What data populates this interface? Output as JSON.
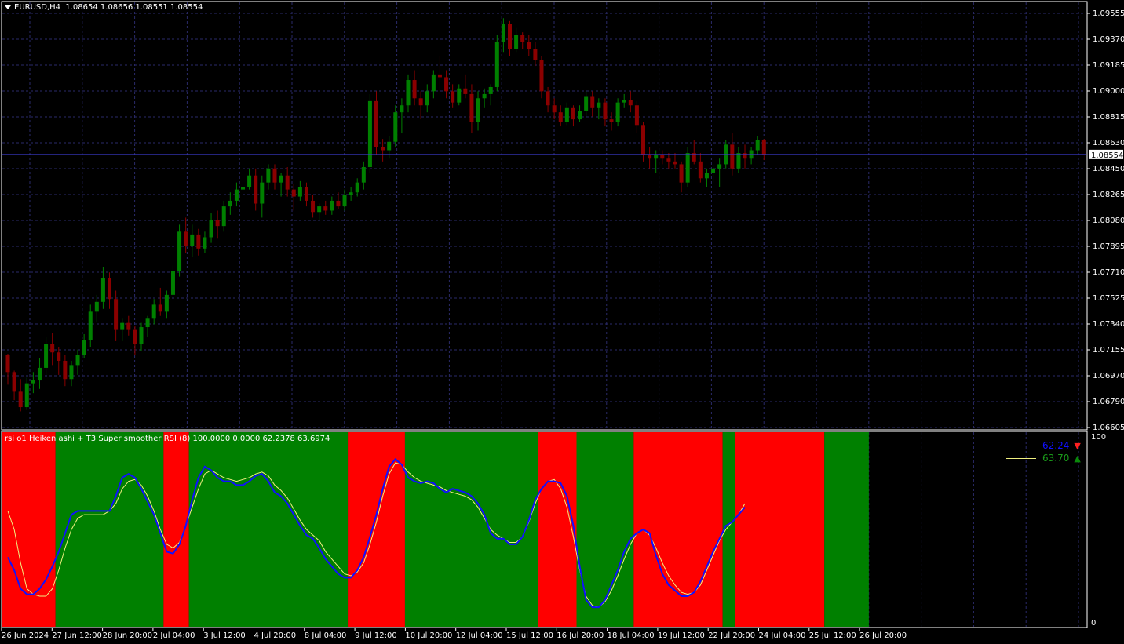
{
  "header": {
    "symbol": "EURUSD,H4",
    "ohlc": "1.08654 1.08656 1.08551 1.08554"
  },
  "price_axis": {
    "ticks": [
      "1.09555",
      "1.09370",
      "1.09185",
      "1.09000",
      "1.08815",
      "1.08630",
      "1.08450",
      "1.08265",
      "1.08080",
      "1.07895",
      "1.07710",
      "1.07525",
      "1.07340",
      "1.07155",
      "1.06970",
      "1.06790",
      "1.06605"
    ],
    "current_price": "1.08554"
  },
  "indicator": {
    "title": "rsi o1 Heiken ashi + T3 Super smoother RSI (8) 100.0000 0.0000 62.2378 63.6974",
    "scale_max": "100",
    "scale_min": "0",
    "legend": [
      {
        "value": "62.24",
        "color": "#1010ff",
        "arrow": "▼",
        "arrow_color": "#ff2020",
        "icon": "down-arrow-icon"
      },
      {
        "value": "63.70",
        "color": "#f0f080",
        "arrow": "▲",
        "arrow_color": "#0a8a0a",
        "icon": "up-arrow-icon"
      }
    ]
  },
  "time_axis": [
    "26 Jun 2024",
    "27 Jun 12:00",
    "28 Jun 20:00",
    "2 Jul 04:00",
    "3 Jul 12:00",
    "4 Jul 20:00",
    "8 Jul 04:00",
    "9 Jul 12:00",
    "10 Jul 20:00",
    "12 Jul 04:00",
    "15 Jul 12:00",
    "16 Jul 20:00",
    "18 Jul 04:00",
    "19 Jul 12:00",
    "22 Jul 20:00",
    "24 Jul 04:00",
    "25 Jul 12:00",
    "26 Jul 20:00"
  ],
  "colors": {
    "background": "#000000",
    "grid": "#2a2a6a",
    "bull": "#008000",
    "bear": "#8b0000",
    "zone_up": "#008000",
    "zone_down": "#ff0000",
    "rsi_line": "#1010ff",
    "signal_line": "#f0f080"
  },
  "chart_data": {
    "type": "candlestick",
    "title": "EURUSD,H4",
    "ylim": [
      1.06605,
      1.09555
    ],
    "candles": [
      [
        1.0712,
        1.0713,
        1.0691,
        1.07
      ],
      [
        1.07,
        1.0701,
        1.068,
        1.0686
      ],
      [
        1.0686,
        1.0695,
        1.0672,
        1.0675
      ],
      [
        1.0675,
        1.0696,
        1.0673,
        1.0692
      ],
      [
        1.0692,
        1.07,
        1.0685,
        1.0694
      ],
      [
        1.0694,
        1.071,
        1.0688,
        1.0703
      ],
      [
        1.0703,
        1.0725,
        1.0698,
        1.072
      ],
      [
        1.072,
        1.0728,
        1.0705,
        1.0714
      ],
      [
        1.0714,
        1.0718,
        1.0698,
        1.0708
      ],
      [
        1.0708,
        1.0712,
        1.069,
        1.0695
      ],
      [
        1.0695,
        1.0708,
        1.069,
        1.0705
      ],
      [
        1.0705,
        1.0716,
        1.0698,
        1.0712
      ],
      [
        1.0712,
        1.0727,
        1.071,
        1.0723
      ],
      [
        1.0723,
        1.0748,
        1.0718,
        1.0743
      ],
      [
        1.0743,
        1.0755,
        1.0736,
        1.075
      ],
      [
        1.075,
        1.0775,
        1.0745,
        1.0767
      ],
      [
        1.0767,
        1.0771,
        1.0745,
        1.0752
      ],
      [
        1.0752,
        1.0758,
        1.0722,
        1.073
      ],
      [
        1.073,
        1.0738,
        1.0722,
        1.0735
      ],
      [
        1.0735,
        1.074,
        1.0726,
        1.073
      ],
      [
        1.073,
        1.0733,
        1.0712,
        1.072
      ],
      [
        1.072,
        1.0735,
        1.0715,
        1.0732
      ],
      [
        1.0732,
        1.074,
        1.0725,
        1.0738
      ],
      [
        1.0738,
        1.0752,
        1.0734,
        1.0748
      ],
      [
        1.0748,
        1.076,
        1.074,
        1.0743
      ],
      [
        1.0743,
        1.0758,
        1.0738,
        1.0755
      ],
      [
        1.0755,
        1.0776,
        1.0752,
        1.0772
      ],
      [
        1.0772,
        1.0805,
        1.0768,
        1.08
      ],
      [
        1.08,
        1.081,
        1.0785,
        1.079
      ],
      [
        1.079,
        1.0805,
        1.0782,
        1.0798
      ],
      [
        1.0798,
        1.0802,
        1.0783,
        1.0788
      ],
      [
        1.0788,
        1.08,
        1.0785,
        1.0796
      ],
      [
        1.0796,
        1.0813,
        1.0792,
        1.0808
      ],
      [
        1.0808,
        1.0815,
        1.0795,
        1.0804
      ],
      [
        1.0804,
        1.0822,
        1.08,
        1.0818
      ],
      [
        1.0818,
        1.0828,
        1.0812,
        1.0822
      ],
      [
        1.0822,
        1.0835,
        1.0818,
        1.083
      ],
      [
        1.083,
        1.084,
        1.082,
        1.0832
      ],
      [
        1.0832,
        1.0845,
        1.083,
        1.084
      ],
      [
        1.084,
        1.0845,
        1.0815,
        1.082
      ],
      [
        1.082,
        1.084,
        1.081,
        1.0835
      ],
      [
        1.0835,
        1.0848,
        1.083,
        1.0845
      ],
      [
        1.0845,
        1.0848,
        1.083,
        1.0835
      ],
      [
        1.0835,
        1.0842,
        1.0825,
        1.084
      ],
      [
        1.084,
        1.0846,
        1.0825,
        1.083
      ],
      [
        1.083,
        1.0834,
        1.0815,
        1.0825
      ],
      [
        1.0825,
        1.0836,
        1.0822,
        1.0832
      ],
      [
        1.0832,
        1.0835,
        1.0818,
        1.0822
      ],
      [
        1.0822,
        1.0826,
        1.081,
        1.0814
      ],
      [
        1.0814,
        1.082,
        1.0808,
        1.0818
      ],
      [
        1.0818,
        1.0822,
        1.0812,
        1.0815
      ],
      [
        1.0815,
        1.0825,
        1.0812,
        1.0822
      ],
      [
        1.0822,
        1.0828,
        1.0816,
        1.0818
      ],
      [
        1.0818,
        1.083,
        1.0815,
        1.0826
      ],
      [
        1.0826,
        1.0832,
        1.0822,
        1.0828
      ],
      [
        1.0828,
        1.0838,
        1.0825,
        1.0835
      ],
      [
        1.0835,
        1.085,
        1.083,
        1.0846
      ],
      [
        1.0846,
        1.0898,
        1.0842,
        1.0893
      ],
      [
        1.0893,
        1.09,
        1.0855,
        1.086
      ],
      [
        1.086,
        1.0866,
        1.085,
        1.0858
      ],
      [
        1.0858,
        1.0868,
        1.0852,
        1.0864
      ],
      [
        1.0864,
        1.089,
        1.086,
        1.0885
      ],
      [
        1.0885,
        1.0895,
        1.087,
        1.089
      ],
      [
        1.089,
        1.0912,
        1.0885,
        1.0908
      ],
      [
        1.0908,
        1.0915,
        1.089,
        1.0895
      ],
      [
        1.0895,
        1.09,
        1.088,
        1.089
      ],
      [
        1.089,
        1.0905,
        1.0885,
        1.09
      ],
      [
        1.09,
        1.0915,
        1.0895,
        1.0912
      ],
      [
        1.0912,
        1.0925,
        1.09,
        1.091
      ],
      [
        1.091,
        1.0915,
        1.0895,
        1.09
      ],
      [
        1.09,
        1.0905,
        1.0888,
        1.0892
      ],
      [
        1.0892,
        1.0905,
        1.089,
        1.0902
      ],
      [
        1.0902,
        1.0912,
        1.0895,
        1.0898
      ],
      [
        1.0898,
        1.0905,
        1.087,
        1.0878
      ],
      [
        1.0878,
        1.09,
        1.0872,
        1.0895
      ],
      [
        1.0895,
        1.0902,
        1.0888,
        1.0898
      ],
      [
        1.0898,
        1.0905,
        1.089,
        1.0903
      ],
      [
        1.0903,
        1.094,
        1.09,
        1.0935
      ],
      [
        1.0935,
        1.0952,
        1.0928,
        1.0948
      ],
      [
        1.0948,
        1.095,
        1.0925,
        1.093
      ],
      [
        1.093,
        1.0945,
        1.0928,
        1.094
      ],
      [
        1.094,
        1.0942,
        1.093,
        1.0935
      ],
      [
        1.0935,
        1.094,
        1.0925,
        1.093
      ],
      [
        1.093,
        1.0935,
        1.0918,
        1.0922
      ],
      [
        1.0922,
        1.0925,
        1.0895,
        1.09
      ],
      [
        1.09,
        1.0903,
        1.0885,
        1.089
      ],
      [
        1.089,
        1.0895,
        1.088,
        1.0885
      ],
      [
        1.0885,
        1.089,
        1.0875,
        1.0878
      ],
      [
        1.0878,
        1.0892,
        1.0876,
        1.0888
      ],
      [
        1.0888,
        1.089,
        1.0875,
        1.088
      ],
      [
        1.088,
        1.089,
        1.0878,
        1.0886
      ],
      [
        1.0886,
        1.09,
        1.0882,
        1.0896
      ],
      [
        1.0896,
        1.09,
        1.0882,
        1.0888
      ],
      [
        1.0888,
        1.0895,
        1.088,
        1.0892
      ],
      [
        1.0892,
        1.0895,
        1.0875,
        1.088
      ],
      [
        1.088,
        1.0885,
        1.0872,
        1.0878
      ],
      [
        1.0878,
        1.0895,
        1.0875,
        1.0892
      ],
      [
        1.0892,
        1.0898,
        1.0888,
        1.0894
      ],
      [
        1.0894,
        1.09,
        1.0885,
        1.089
      ],
      [
        1.089,
        1.0893,
        1.087,
        1.0876
      ],
      [
        1.0876,
        1.0878,
        1.085,
        1.0855
      ],
      [
        1.0855,
        1.086,
        1.0845,
        1.0852
      ],
      [
        1.0852,
        1.0858,
        1.0842,
        1.0855
      ],
      [
        1.0855,
        1.0858,
        1.0848,
        1.0852
      ],
      [
        1.0852,
        1.0856,
        1.0845,
        1.085
      ],
      [
        1.085,
        1.0856,
        1.0845,
        1.0848
      ],
      [
        1.0848,
        1.085,
        1.0828,
        1.0835
      ],
      [
        1.0835,
        1.086,
        1.0832,
        1.0856
      ],
      [
        1.0856,
        1.0865,
        1.0848,
        1.085
      ],
      [
        1.085,
        1.0856,
        1.0835,
        1.0838
      ],
      [
        1.0838,
        1.0845,
        1.0832,
        1.0842
      ],
      [
        1.0842,
        1.0848,
        1.0835,
        1.0845
      ],
      [
        1.0845,
        1.0852,
        1.0832,
        1.0848
      ],
      [
        1.0848,
        1.0865,
        1.0845,
        1.0862
      ],
      [
        1.0862,
        1.087,
        1.084,
        1.0845
      ],
      [
        1.0845,
        1.086,
        1.0842,
        1.0856
      ],
      [
        1.0856,
        1.0862,
        1.0845,
        1.0852
      ],
      [
        1.0852,
        1.086,
        1.0848,
        1.0858
      ],
      [
        1.0858,
        1.0868,
        1.0855,
        1.0865
      ],
      [
        1.0865,
        1.0866,
        1.0851,
        1.0855
      ]
    ]
  },
  "indicator_data": {
    "scale": [
      0,
      100
    ],
    "zones": [
      {
        "from": 0,
        "to": 8,
        "state": "down"
      },
      {
        "from": 8,
        "to": 25,
        "state": "up"
      },
      {
        "from": 25,
        "to": 29,
        "state": "down"
      },
      {
        "from": 29,
        "to": 54,
        "state": "up"
      },
      {
        "from": 54,
        "to": 63,
        "state": "down"
      },
      {
        "from": 63,
        "to": 84,
        "state": "up"
      },
      {
        "from": 84,
        "to": 90,
        "state": "down"
      },
      {
        "from": 90,
        "to": 99,
        "state": "up"
      },
      {
        "from": 99,
        "to": 113,
        "state": "down"
      },
      {
        "from": 113,
        "to": 115,
        "state": "up"
      },
      {
        "from": 115,
        "to": 129,
        "state": "down"
      },
      {
        "from": 129,
        "to": 136,
        "state": "up"
      }
    ],
    "rsi": [
      35,
      28,
      18,
      15,
      15,
      18,
      23,
      30,
      38,
      48,
      58,
      60,
      60,
      60,
      60,
      60,
      60,
      68,
      78,
      80,
      78,
      72,
      65,
      58,
      48,
      38,
      37,
      42,
      52,
      66,
      78,
      84,
      82,
      78,
      76,
      76,
      74,
      74,
      76,
      79,
      80,
      76,
      70,
      68,
      64,
      58,
      52,
      47,
      45,
      40,
      34,
      30,
      26,
      24,
      24,
      28,
      35,
      46,
      58,
      72,
      84,
      88,
      85,
      78,
      76,
      75,
      76,
      75,
      72,
      70,
      72,
      71,
      70,
      68,
      64,
      58,
      48,
      45,
      45,
      42,
      42,
      46,
      55,
      66,
      72,
      76,
      76,
      75,
      68,
      52,
      30,
      12,
      8,
      8,
      12,
      20,
      28,
      38,
      45,
      48,
      50,
      48,
      36,
      26,
      20,
      17,
      14,
      14,
      16,
      22,
      30,
      38,
      45,
      52,
      54,
      58,
      62
    ],
    "signal": [
      60,
      50,
      32,
      18,
      15,
      14,
      14,
      18,
      28,
      40,
      50,
      56,
      58,
      58,
      58,
      58,
      60,
      64,
      72,
      76,
      77,
      74,
      68,
      60,
      50,
      42,
      40,
      43,
      52,
      62,
      72,
      80,
      82,
      80,
      78,
      77,
      76,
      77,
      78,
      80,
      81,
      79,
      74,
      71,
      67,
      61,
      55,
      50,
      47,
      44,
      38,
      34,
      30,
      26,
      25,
      27,
      32,
      42,
      54,
      68,
      80,
      86,
      85,
      81,
      78,
      76,
      75,
      74,
      73,
      71,
      70,
      69,
      68,
      66,
      62,
      56,
      50,
      47,
      45,
      43,
      43,
      46,
      54,
      64,
      72,
      76,
      77,
      72,
      62,
      46,
      28,
      14,
      9,
      8,
      11,
      17,
      25,
      34,
      42,
      48,
      50,
      47,
      40,
      32,
      25,
      20,
      16,
      15,
      16,
      20,
      28,
      36,
      44,
      50,
      54,
      58,
      64
    ]
  }
}
